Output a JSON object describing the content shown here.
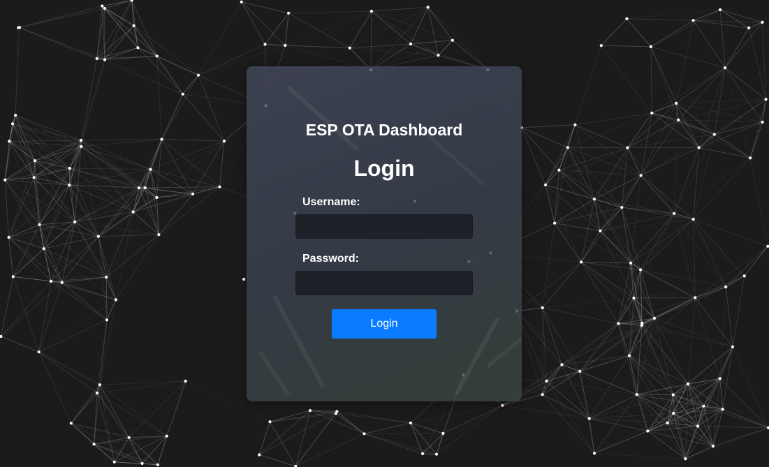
{
  "app": {
    "title": "ESP OTA Dashboard"
  },
  "login_form": {
    "heading": "Login",
    "username_label": "Username:",
    "username_value": "",
    "password_label": "Password:",
    "password_value": "",
    "submit_label": "Login"
  },
  "theme": {
    "background": "#1b1b1b",
    "accent": "#0a7cff",
    "network_line": "#9a9a9a",
    "network_node": "#ffffff"
  }
}
